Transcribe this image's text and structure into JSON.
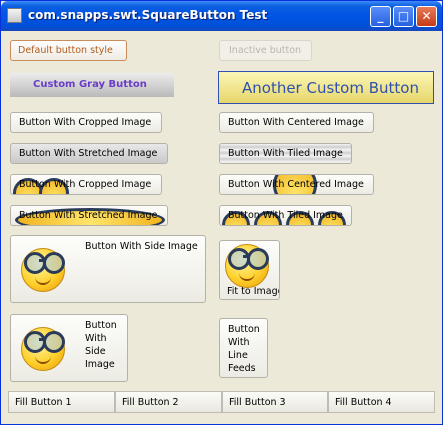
{
  "window": {
    "title": "com.snapps.swt.SquareButton Test",
    "minimize_glyph": "_",
    "maximize_glyph": "□",
    "close_glyph": "✕"
  },
  "buttons": {
    "default_style": "Default button style",
    "inactive": "Inactive button",
    "custom_gray": "Custom Gray Button",
    "another_custom": "Another Custom Button",
    "cropped_image_1": "Button With Cropped Image",
    "centered_image_1": "Button With Centered Image",
    "stretched_image_1": "Button With Stretched Image",
    "tiled_image_1": "Button With Tiled Image",
    "cropped_image_2": "Button With Cropped Image",
    "centered_image_2": "Button With Centered Image",
    "stretched_image_2": "Button With Stretched Image",
    "tiled_image_2": "Button With Tiled Image",
    "side_image": "Button With Side Image",
    "fit_to_image": "Fit to Image",
    "side_image_wrapped": [
      "Button",
      "With",
      "Side",
      "Image"
    ],
    "line_feeds": [
      "Button",
      "With",
      "Line",
      "Feeds"
    ]
  },
  "fill_buttons": [
    "Fill Button 1",
    "Fill Button 2",
    "Fill Button 3",
    "Fill Button 4"
  ],
  "colors": {
    "titlebar": "#0054e3",
    "default_text": "#b05a1e",
    "custom_gray_text": "#6a3cc8",
    "another_custom_text": "#3050b0",
    "another_custom_bg": "#f3e98a"
  },
  "icons": {
    "window_icon": "app-window-icon",
    "smiley": "smiley-glasses-icon"
  }
}
